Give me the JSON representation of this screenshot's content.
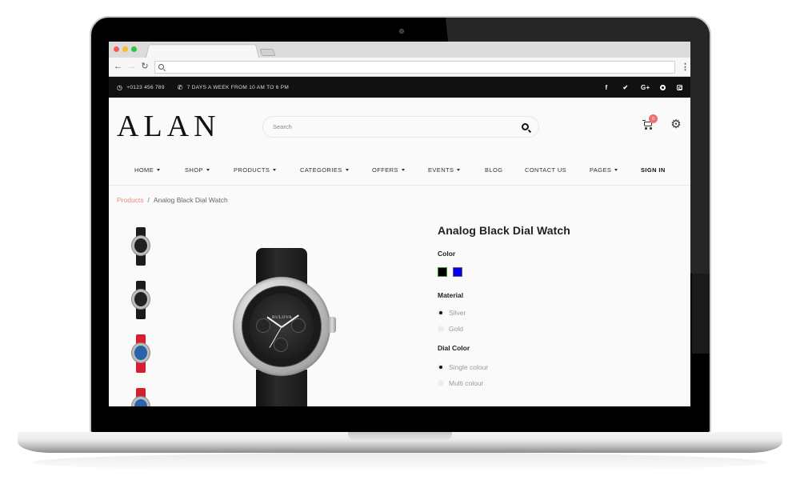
{
  "browser": {
    "traffic_lights": [
      "#f25f58",
      "#f8bc2f",
      "#2dc840"
    ],
    "url": "",
    "back_icon": "←",
    "forward_icon": "→",
    "reload_icon": "↻",
    "menu_icon": "⋮"
  },
  "topbar": {
    "phone": "+0123 456 789",
    "hours": "7 DAYS A WEEK FROM 10 AM TO 6 PM",
    "socials": [
      {
        "name": "facebook",
        "glyph": "f"
      },
      {
        "name": "twitter",
        "glyph": "🐦"
      },
      {
        "name": "google-plus",
        "glyph": "G+"
      },
      {
        "name": "pinterest",
        "glyph": ""
      },
      {
        "name": "instagram",
        "glyph": ""
      }
    ]
  },
  "header": {
    "logo": "ALAN",
    "search_placeholder": "Search",
    "cart_count": "0",
    "settings_icon": "⚙"
  },
  "nav": {
    "items": [
      {
        "label": "HOME",
        "dropdown": true
      },
      {
        "label": "SHOP",
        "dropdown": true
      },
      {
        "label": "PRODUCTS",
        "dropdown": true
      },
      {
        "label": "CATEGORIES",
        "dropdown": true
      },
      {
        "label": "OFFERS",
        "dropdown": true
      },
      {
        "label": "EVENTS",
        "dropdown": true
      },
      {
        "label": "BLOG",
        "dropdown": false
      },
      {
        "label": "CONTACT US",
        "dropdown": false
      },
      {
        "label": "PAGES",
        "dropdown": true
      },
      {
        "label": "SIGN IN",
        "dropdown": false,
        "bold": true
      }
    ]
  },
  "breadcrumb": {
    "parent": "Products",
    "separator": "/",
    "current": "Analog Black Dial Watch"
  },
  "gallery": {
    "thumbnails": [
      {
        "strap": "#1b1b1b",
        "dial": "#222222"
      },
      {
        "strap": "#1b1b1b",
        "dial": "#222222"
      },
      {
        "strap": "#d62030",
        "dial": "#2a63a8"
      },
      {
        "strap": "#d62030",
        "dial": "#2a63a8"
      }
    ],
    "main_brand": "BULOVA"
  },
  "product": {
    "title": "Analog Black Dial Watch",
    "color_label": "Color",
    "colors": [
      {
        "name": "black",
        "hex": "#000000",
        "selected": true
      },
      {
        "name": "blue",
        "hex": "#0000ff",
        "selected": false
      }
    ],
    "material_label": "Material",
    "materials": [
      {
        "label": "Silver",
        "checked": true
      },
      {
        "label": "Gold",
        "checked": false
      }
    ],
    "dial_color_label": "Dial Color",
    "dial_colors": [
      {
        "label": "Single colour",
        "checked": true
      },
      {
        "label": "Multi colour",
        "checked": false
      }
    ]
  }
}
